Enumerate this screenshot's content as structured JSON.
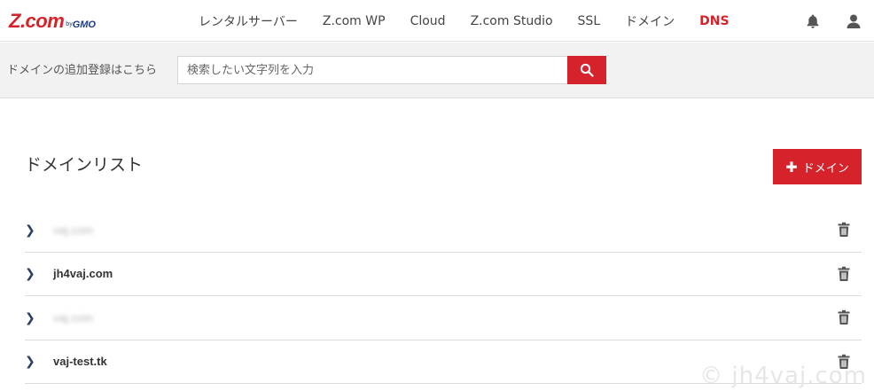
{
  "header": {
    "logo_main": "Z.com",
    "logo_by": "by",
    "logo_gmo": "GMO",
    "nav": [
      {
        "label": "レンタルサーバー",
        "active": false
      },
      {
        "label": "Z.com WP",
        "active": false
      },
      {
        "label": "Cloud",
        "active": false
      },
      {
        "label": "Z.com Studio",
        "active": false
      },
      {
        "label": "SSL",
        "active": false
      },
      {
        "label": "ドメイン",
        "active": false
      },
      {
        "label": "DNS",
        "active": true
      }
    ],
    "icons": [
      "bell-icon",
      "user-icon"
    ]
  },
  "search": {
    "label": "ドメインの追加登録はこちら",
    "placeholder": "検索したい文字列を入力",
    "value": ""
  },
  "main": {
    "title": "ドメインリスト",
    "add_button_label": "ドメイン",
    "domains": [
      {
        "name": "vaj.com",
        "blurred": true
      },
      {
        "name": "jh4vaj.com",
        "blurred": false
      },
      {
        "name": "vaj.com",
        "blurred": true
      },
      {
        "name": "vaj-test.tk",
        "blurred": false
      }
    ]
  },
  "watermark": "© jh4vaj.com",
  "colors": {
    "accent": "#d6222a",
    "brand_blue": "#1a3a8a"
  }
}
